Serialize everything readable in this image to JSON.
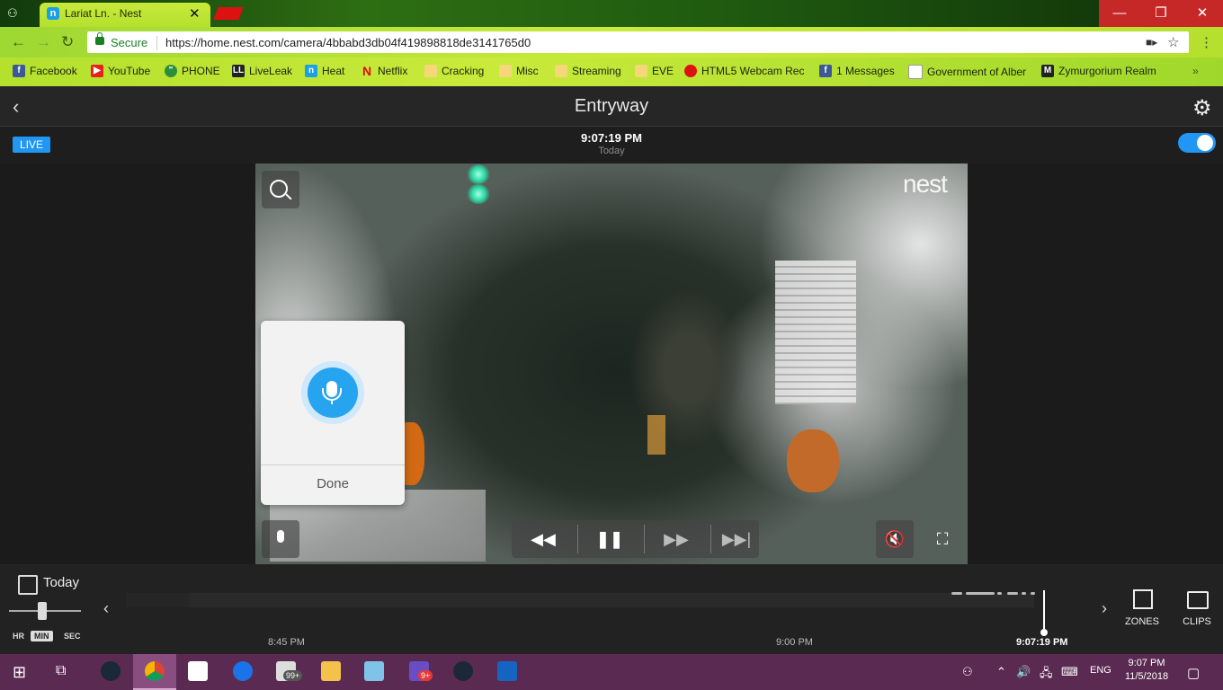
{
  "browser": {
    "tab_title": "Lariat Ln. - Nest",
    "secure_label": "Secure",
    "url": "https://home.nest.com/camera/4bbabd3db04f419898818de3141765d0",
    "bookmarks": [
      "Facebook",
      "YouTube",
      "PHONE",
      "LiveLeak",
      "Heat",
      "Netflix",
      "Cracking",
      "Misc",
      "Streaming",
      "EVE",
      "HTML5 Webcam Rec",
      "1 Messages",
      "Government of Alber",
      "Zymurgorium Realm"
    ]
  },
  "camera": {
    "title": "Entryway",
    "live_label": "LIVE",
    "time": "9:07:19 PM",
    "day": "Today",
    "logo": "nest",
    "talk_done_label": "Done"
  },
  "timeline": {
    "date_label": "Today",
    "scale": [
      "HR",
      "MIN",
      "SEC"
    ],
    "ticks": [
      "8:45 PM",
      "9:00 PM",
      "9:07:19 PM"
    ],
    "zones_label": "ZONES",
    "clips_label": "CLIPS"
  },
  "taskbar": {
    "notif_badge_1": "99+",
    "notif_badge_2": "9+",
    "lang": "ENG",
    "time": "9:07 PM",
    "date": "11/5/2018"
  },
  "colors": {
    "accent": "#2196f3",
    "mic": "#27a4f0",
    "taskbar": "#5b2a52"
  }
}
